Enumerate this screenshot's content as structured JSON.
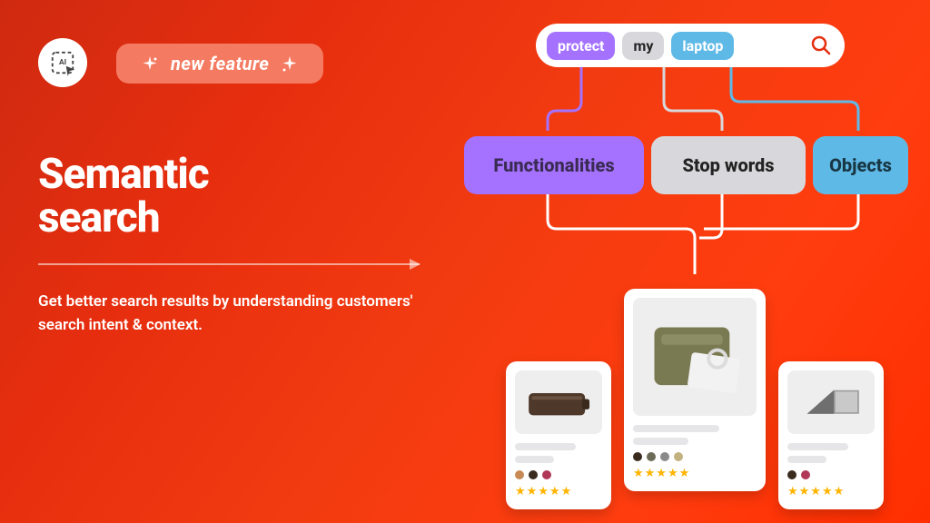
{
  "header": {
    "badge_label": "new feature"
  },
  "hero": {
    "title_line1": "Semantic",
    "title_line2": "search",
    "subtitle": "Get better search results by understanding customers' search intent & context."
  },
  "diagram": {
    "search_chips": {
      "chip1": "protect",
      "chip2": "my",
      "chip3": "laptop"
    },
    "categories": {
      "functionalities": "Functionalities",
      "stop_words": "Stop words",
      "objects": "Objects"
    },
    "colors": {
      "purple": "#a472ff",
      "grey": "#d8d8dc",
      "blue": "#5fb9e6",
      "star": "#ffb400"
    },
    "products": [
      {
        "stars": 5,
        "swatches": [
          "#c78a55",
          "#3a2b1f",
          "#b03758"
        ]
      },
      {
        "stars": 5,
        "swatches": [
          "#3a2b1f",
          "#6b6b57",
          "#8a8a8a",
          "#c2b280"
        ]
      },
      {
        "stars": 5,
        "swatches": [
          "#3a2b1f",
          "#b03758"
        ]
      }
    ]
  }
}
